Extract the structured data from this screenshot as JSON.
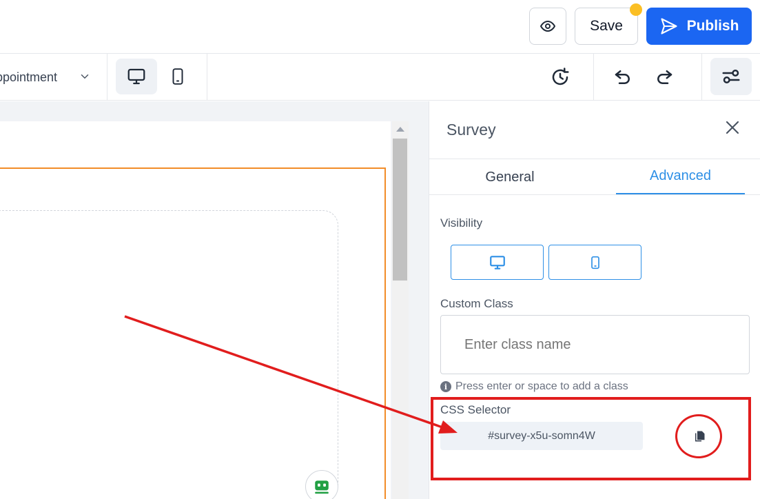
{
  "header": {
    "save_label": "Save",
    "publish_label": "Publish",
    "preview_icon": "eye-icon",
    "publish_icon": "send-icon",
    "unsaved_indicator_color": "#fbbf24",
    "publish_color": "#1b66f2"
  },
  "toolbar": {
    "page_name": "ppointment",
    "device_desktop_icon": "desktop-icon",
    "device_mobile_icon": "mobile-icon",
    "history_icon": "history-icon",
    "undo_icon": "undo-icon",
    "redo_icon": "redo-icon",
    "settings_icon": "sliders-icon"
  },
  "panel": {
    "title": "Survey",
    "tabs": [
      {
        "label": "General",
        "active": false
      },
      {
        "label": "Advanced",
        "active": true
      }
    ],
    "visibility_label": "Visibility",
    "custom_class_label": "Custom Class",
    "custom_class_placeholder": "Enter class name",
    "custom_class_hint": "Press enter or space to add a class",
    "css_selector_label": "CSS Selector",
    "css_selector_value": "#survey-x5u-somn4W",
    "accent_color": "#2d8fe6"
  },
  "annotations": {
    "highlight_color": "#e11d1d"
  }
}
